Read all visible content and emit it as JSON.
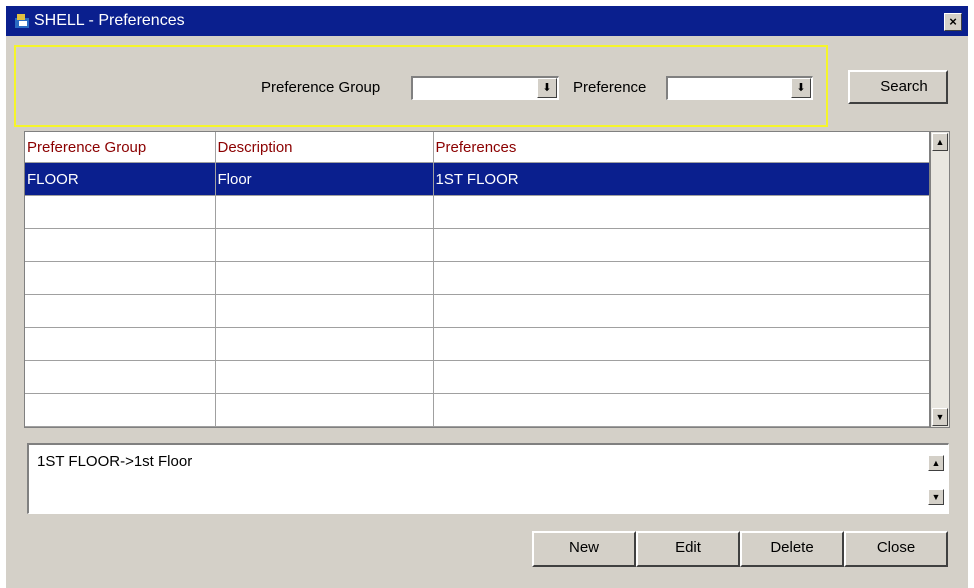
{
  "window": {
    "title": "SHELL - Preferences",
    "close_label": "×"
  },
  "search": {
    "group_label": "Preference Group",
    "group_value": "",
    "pref_label": "Preference",
    "pref_value": "",
    "search_label": "Search",
    "dropdown_glyph": "⬇"
  },
  "grid": {
    "headers": [
      "Preference Group",
      "Description",
      "Preferences"
    ],
    "rows": [
      [
        "FLOOR",
        "Floor",
        "1ST FLOOR"
      ],
      [
        "",
        "",
        ""
      ],
      [
        "",
        "",
        ""
      ],
      [
        "",
        "",
        ""
      ],
      [
        "",
        "",
        ""
      ],
      [
        "",
        "",
        ""
      ],
      [
        "",
        "",
        ""
      ],
      [
        "",
        "",
        ""
      ]
    ]
  },
  "description": {
    "text": "1ST FLOOR->1st Floor"
  },
  "buttons": {
    "new_label": "New",
    "edit_label": "Edit",
    "delete_label": "Delete",
    "close_label": "Close"
  },
  "colors": {
    "title_bar": "#0a1f8e",
    "header_text": "#8b0000",
    "selected_row": "#0a1f8e",
    "search_panel_border": "#f5f52a"
  }
}
